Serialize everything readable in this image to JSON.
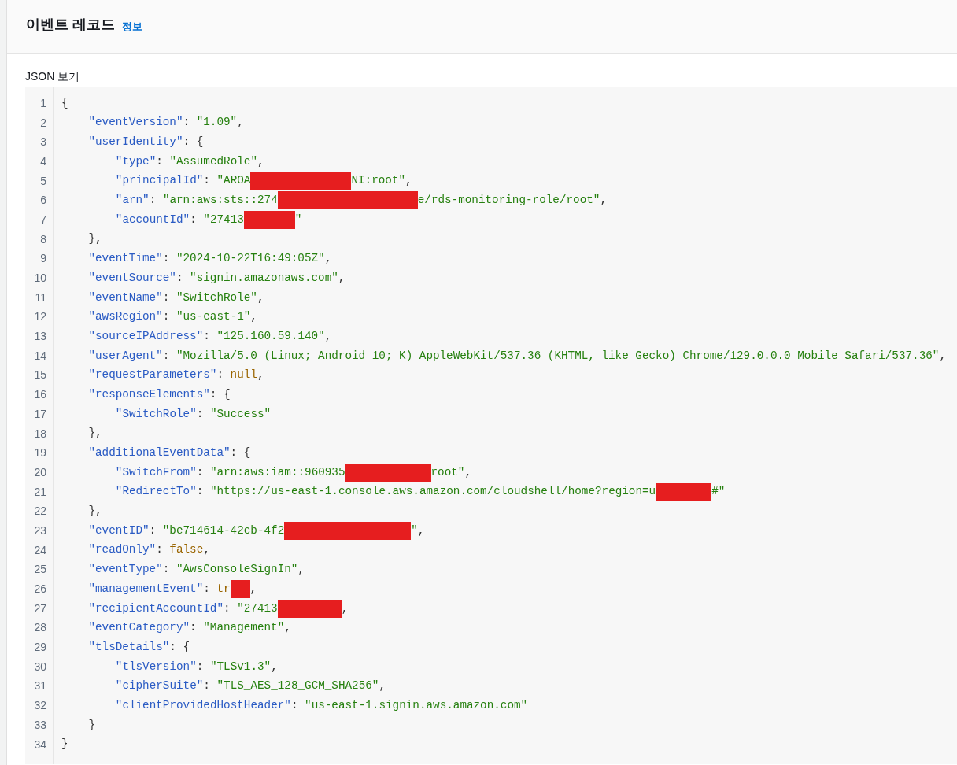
{
  "panel": {
    "title": "이벤트 레코드",
    "info_link": "정보"
  },
  "json_view": {
    "label": "JSON 보기",
    "lines": [
      {
        "number": "1",
        "tokens": [
          {
            "kind": "punct",
            "text": "{"
          }
        ],
        "children": [
          {
            "number": "2",
            "tokens": [
              {
                "kind": "key",
                "text": "\"eventVersion\""
              },
              {
                "kind": "punct",
                "text": ": "
              },
              {
                "kind": "string",
                "text": "\"1.09\""
              },
              {
                "kind": "punct",
                "text": ","
              }
            ]
          },
          {
            "number": "3",
            "tokens": [
              {
                "kind": "key",
                "text": "\"userIdentity\""
              },
              {
                "kind": "punct",
                "text": ": {"
              }
            ],
            "children": [
              {
                "number": "4",
                "tokens": [
                  {
                    "kind": "key",
                    "text": "\"type\""
                  },
                  {
                    "kind": "punct",
                    "text": ": "
                  },
                  {
                    "kind": "string",
                    "text": "\"AssumedRole\""
                  },
                  {
                    "kind": "punct",
                    "text": ","
                  }
                ]
              },
              {
                "number": "5",
                "tokens": [
                  {
                    "kind": "key",
                    "text": "\"principalId\""
                  },
                  {
                    "kind": "punct",
                    "text": ": "
                  },
                  {
                    "kind": "string",
                    "text": "\"AROA"
                  },
                  {
                    "kind": "redacted"
                  },
                  {
                    "kind": "string",
                    "text": "NI:root\""
                  },
                  {
                    "kind": "punct",
                    "text": ","
                  }
                ]
              },
              {
                "number": "6",
                "tokens": [
                  {
                    "kind": "key",
                    "text": "\"arn\""
                  },
                  {
                    "kind": "punct",
                    "text": ": "
                  },
                  {
                    "kind": "string",
                    "text": "\"arn:aws:sts::274"
                  },
                  {
                    "kind": "redacted"
                  },
                  {
                    "kind": "string",
                    "text": "e/rds-monitoring-role/root\""
                  },
                  {
                    "kind": "punct",
                    "text": ","
                  }
                ]
              },
              {
                "number": "7",
                "tokens": [
                  {
                    "kind": "key",
                    "text": "\"accountId\""
                  },
                  {
                    "kind": "punct",
                    "text": ": "
                  },
                  {
                    "kind": "string",
                    "text": "\"27413"
                  },
                  {
                    "kind": "redacted"
                  },
                  {
                    "kind": "string",
                    "text": "\""
                  }
                ]
              }
            ]
          },
          {
            "number": "8",
            "tokens": [
              {
                "kind": "punct",
                "text": "},"
              }
            ]
          },
          {
            "number": "9",
            "tokens": [
              {
                "kind": "key",
                "text": "\"eventTime\""
              },
              {
                "kind": "punct",
                "text": ": "
              },
              {
                "kind": "string",
                "text": "\"2024-10-22T16:49:05Z\""
              },
              {
                "kind": "punct",
                "text": ","
              }
            ]
          },
          {
            "number": "10",
            "tokens": [
              {
                "kind": "key",
                "text": "\"eventSource\""
              },
              {
                "kind": "punct",
                "text": ": "
              },
              {
                "kind": "string",
                "text": "\"signin.amazonaws.com\""
              },
              {
                "kind": "punct",
                "text": ","
              }
            ]
          },
          {
            "number": "11",
            "tokens": [
              {
                "kind": "key",
                "text": "\"eventName\""
              },
              {
                "kind": "punct",
                "text": ": "
              },
              {
                "kind": "string",
                "text": "\"SwitchRole\""
              },
              {
                "kind": "punct",
                "text": ","
              }
            ]
          },
          {
            "number": "12",
            "tokens": [
              {
                "kind": "key",
                "text": "\"awsRegion\""
              },
              {
                "kind": "punct",
                "text": ": "
              },
              {
                "kind": "string",
                "text": "\"us-east-1\""
              },
              {
                "kind": "punct",
                "text": ","
              }
            ]
          },
          {
            "number": "13",
            "tokens": [
              {
                "kind": "key",
                "text": "\"sourceIPAddress\""
              },
              {
                "kind": "punct",
                "text": ": "
              },
              {
                "kind": "string",
                "text": "\"125.160.59.140\""
              },
              {
                "kind": "punct",
                "text": ","
              }
            ]
          },
          {
            "number": "14",
            "tokens": [
              {
                "kind": "key",
                "text": "\"userAgent\""
              },
              {
                "kind": "punct",
                "text": ": "
              },
              {
                "kind": "string",
                "text": "\"Mozilla/5.0 (Linux; Android 10; K) AppleWebKit/537.36 (KHTML, like Gecko) Chrome/129.0.0.0 Mobile Safari/537.36\""
              },
              {
                "kind": "punct",
                "text": ","
              }
            ]
          },
          {
            "number": "15",
            "tokens": [
              {
                "kind": "key",
                "text": "\"requestParameters\""
              },
              {
                "kind": "punct",
                "text": ": "
              },
              {
                "kind": "literal",
                "text": "null"
              },
              {
                "kind": "punct",
                "text": ","
              }
            ]
          },
          {
            "number": "16",
            "tokens": [
              {
                "kind": "key",
                "text": "\"responseElements\""
              },
              {
                "kind": "punct",
                "text": ": {"
              }
            ],
            "children": [
              {
                "number": "17",
                "tokens": [
                  {
                    "kind": "key",
                    "text": "\"SwitchRole\""
                  },
                  {
                    "kind": "punct",
                    "text": ": "
                  },
                  {
                    "kind": "string",
                    "text": "\"Success\""
                  }
                ]
              }
            ]
          },
          {
            "number": "18",
            "tokens": [
              {
                "kind": "punct",
                "text": "},"
              }
            ]
          },
          {
            "number": "19",
            "tokens": [
              {
                "kind": "key",
                "text": "\"additionalEventData\""
              },
              {
                "kind": "punct",
                "text": ": {"
              }
            ],
            "children": [
              {
                "number": "20",
                "tokens": [
                  {
                    "kind": "key",
                    "text": "\"SwitchFrom\""
                  },
                  {
                    "kind": "punct",
                    "text": ": "
                  },
                  {
                    "kind": "string",
                    "text": "\"arn:aws:iam::960935"
                  },
                  {
                    "kind": "redacted"
                  },
                  {
                    "kind": "string",
                    "text": "root\""
                  },
                  {
                    "kind": "punct",
                    "text": ","
                  }
                ]
              },
              {
                "number": "21",
                "tokens": [
                  {
                    "kind": "key",
                    "text": "\"RedirectTo\""
                  },
                  {
                    "kind": "punct",
                    "text": ": "
                  },
                  {
                    "kind": "string",
                    "text": "\"https://us-east-1.console.aws.amazon.com/cloudshell/home?region=u"
                  },
                  {
                    "kind": "redacted"
                  },
                  {
                    "kind": "string",
                    "text": "#\""
                  }
                ]
              }
            ]
          },
          {
            "number": "22",
            "tokens": [
              {
                "kind": "punct",
                "text": "},"
              }
            ]
          },
          {
            "number": "23",
            "tokens": [
              {
                "kind": "key",
                "text": "\"eventID\""
              },
              {
                "kind": "punct",
                "text": ": "
              },
              {
                "kind": "string",
                "text": "\"be714614-42cb-4f2"
              },
              {
                "kind": "redacted"
              },
              {
                "kind": "string",
                "text": "\""
              },
              {
                "kind": "punct",
                "text": ","
              }
            ]
          },
          {
            "number": "24",
            "tokens": [
              {
                "kind": "key",
                "text": "\"readOnly\""
              },
              {
                "kind": "punct",
                "text": ": "
              },
              {
                "kind": "literal",
                "text": "false"
              },
              {
                "kind": "punct",
                "text": ","
              }
            ]
          },
          {
            "number": "25",
            "tokens": [
              {
                "kind": "key",
                "text": "\"eventType\""
              },
              {
                "kind": "punct",
                "text": ": "
              },
              {
                "kind": "string",
                "text": "\"AwsConsoleSignIn\""
              },
              {
                "kind": "punct",
                "text": ","
              }
            ]
          },
          {
            "number": "26",
            "tokens": [
              {
                "kind": "key",
                "text": "\"managementEvent\""
              },
              {
                "kind": "punct",
                "text": ": "
              },
              {
                "kind": "literal",
                "text": "tr"
              },
              {
                "kind": "redacted"
              },
              {
                "kind": "punct",
                "text": ","
              }
            ]
          },
          {
            "number": "27",
            "tokens": [
              {
                "kind": "key",
                "text": "\"recipientAccountId\""
              },
              {
                "kind": "punct",
                "text": ": "
              },
              {
                "kind": "string",
                "text": "\"27413"
              },
              {
                "kind": "redacted"
              },
              {
                "kind": "punct",
                "text": ","
              }
            ]
          },
          {
            "number": "28",
            "tokens": [
              {
                "kind": "key",
                "text": "\"eventCategory\""
              },
              {
                "kind": "punct",
                "text": ": "
              },
              {
                "kind": "string",
                "text": "\"Management\""
              },
              {
                "kind": "punct",
                "text": ","
              }
            ]
          },
          {
            "number": "29",
            "tokens": [
              {
                "kind": "key",
                "text": "\"tlsDetails\""
              },
              {
                "kind": "punct",
                "text": ": {"
              }
            ],
            "children": [
              {
                "number": "30",
                "tokens": [
                  {
                    "kind": "key",
                    "text": "\"tlsVersion\""
                  },
                  {
                    "kind": "punct",
                    "text": ": "
                  },
                  {
                    "kind": "string",
                    "text": "\"TLSv1.3\""
                  },
                  {
                    "kind": "punct",
                    "text": ","
                  }
                ]
              },
              {
                "number": "31",
                "tokens": [
                  {
                    "kind": "key",
                    "text": "\"cipherSuite\""
                  },
                  {
                    "kind": "punct",
                    "text": ": "
                  },
                  {
                    "kind": "string",
                    "text": "\"TLS_AES_128_GCM_SHA256\""
                  },
                  {
                    "kind": "punct",
                    "text": ","
                  }
                ]
              },
              {
                "number": "32",
                "tokens": [
                  {
                    "kind": "key",
                    "text": "\"clientProvidedHostHeader\""
                  },
                  {
                    "kind": "punct",
                    "text": ": "
                  },
                  {
                    "kind": "string",
                    "text": "\"us-east-1.signin.aws.amazon.com\""
                  }
                ]
              }
            ]
          },
          {
            "number": "33",
            "tokens": [
              {
                "kind": "punct",
                "text": "}"
              }
            ]
          }
        ]
      },
      {
        "number": "34",
        "tokens": [
          {
            "kind": "punct",
            "text": "}"
          }
        ]
      }
    ]
  }
}
